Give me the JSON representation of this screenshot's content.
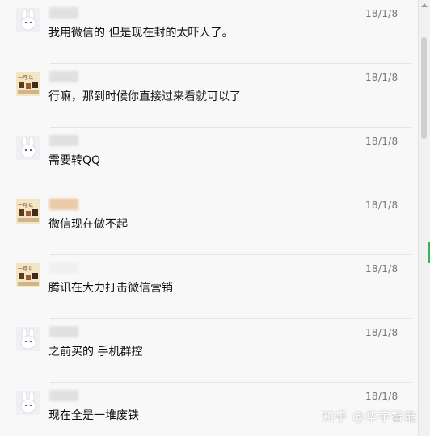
{
  "messages": [
    {
      "avatar": "bunny-avatar",
      "time": "18/1/8",
      "text": "我用微信的  但是现在封的太吓人了。"
    },
    {
      "avatar": "photo-avatar",
      "time": "18/1/8",
      "text": "行嘛，那到时候你直接过来看就可以了"
    },
    {
      "avatar": "bunny-avatar",
      "time": "18/1/8",
      "text": "需要转QQ"
    },
    {
      "avatar": "photo-avatar",
      "time": "18/1/8",
      "text": "微信现在做不起"
    },
    {
      "avatar": "photo-avatar",
      "time": "18/1/8",
      "text": "腾讯在大力打击微信营销"
    },
    {
      "avatar": "bunny-avatar",
      "time": "18/1/8",
      "text": "之前买的 手机群控"
    },
    {
      "avatar": "bunny-avatar",
      "time": "18/1/8",
      "text": "现在全是一堆废铁"
    }
  ],
  "watermark": "知乎 @华宇智能"
}
